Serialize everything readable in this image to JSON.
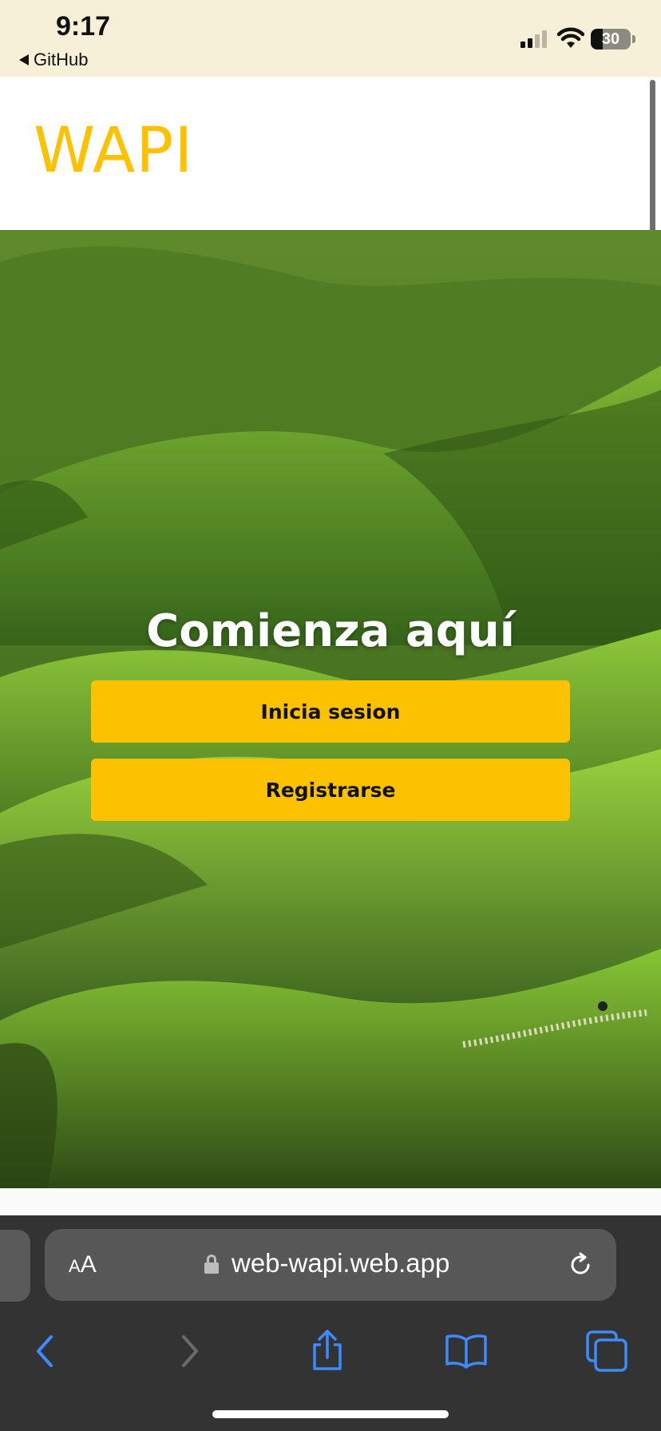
{
  "status_bar": {
    "time": "9:17",
    "back_app": "GitHub",
    "battery_level": "30",
    "icons": [
      "signal-icon",
      "wifi-icon",
      "battery-icon"
    ]
  },
  "header": {
    "logo": "WAPI",
    "brand_color": "#fcc200"
  },
  "hero": {
    "title": "Comienza aquí",
    "buttons": {
      "login": "Inicia sesion",
      "register": "Registrarse"
    }
  },
  "browser": {
    "text_size_label_small": "A",
    "text_size_label_big": "A",
    "url": "web-wapi.web.app",
    "toolbar_icons": [
      "back-icon",
      "forward-icon",
      "share-icon",
      "bookmarks-icon",
      "tabs-icon"
    ],
    "accent_color": "#3d8bff"
  }
}
